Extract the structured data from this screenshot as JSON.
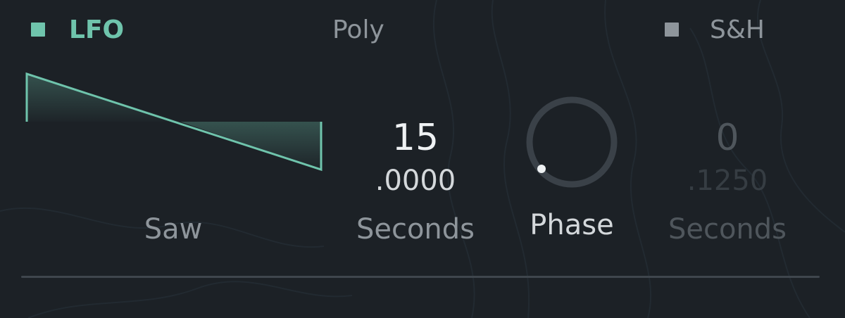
{
  "header": {
    "lfo_label": "LFO",
    "poly_label": "Poly",
    "sh_label": "S&H"
  },
  "waveform": {
    "label": "Saw"
  },
  "rate": {
    "value_whole": "15",
    "value_fraction": ".0000",
    "unit_label": "Seconds"
  },
  "phase": {
    "label": "Phase"
  },
  "sh_rate": {
    "value_whole": "0",
    "value_fraction": ".1250",
    "unit_label": "Seconds"
  },
  "colors": {
    "background": "#1c2126",
    "accent": "#6fc4ac",
    "text_primary": "#eef1f3",
    "text_secondary": "#8e959b",
    "text_disabled": "#4f565c",
    "divider": "#3f464d"
  },
  "icons": {
    "lfo_toggle": "filled-square-icon",
    "sh_toggle": "filled-square-icon"
  }
}
